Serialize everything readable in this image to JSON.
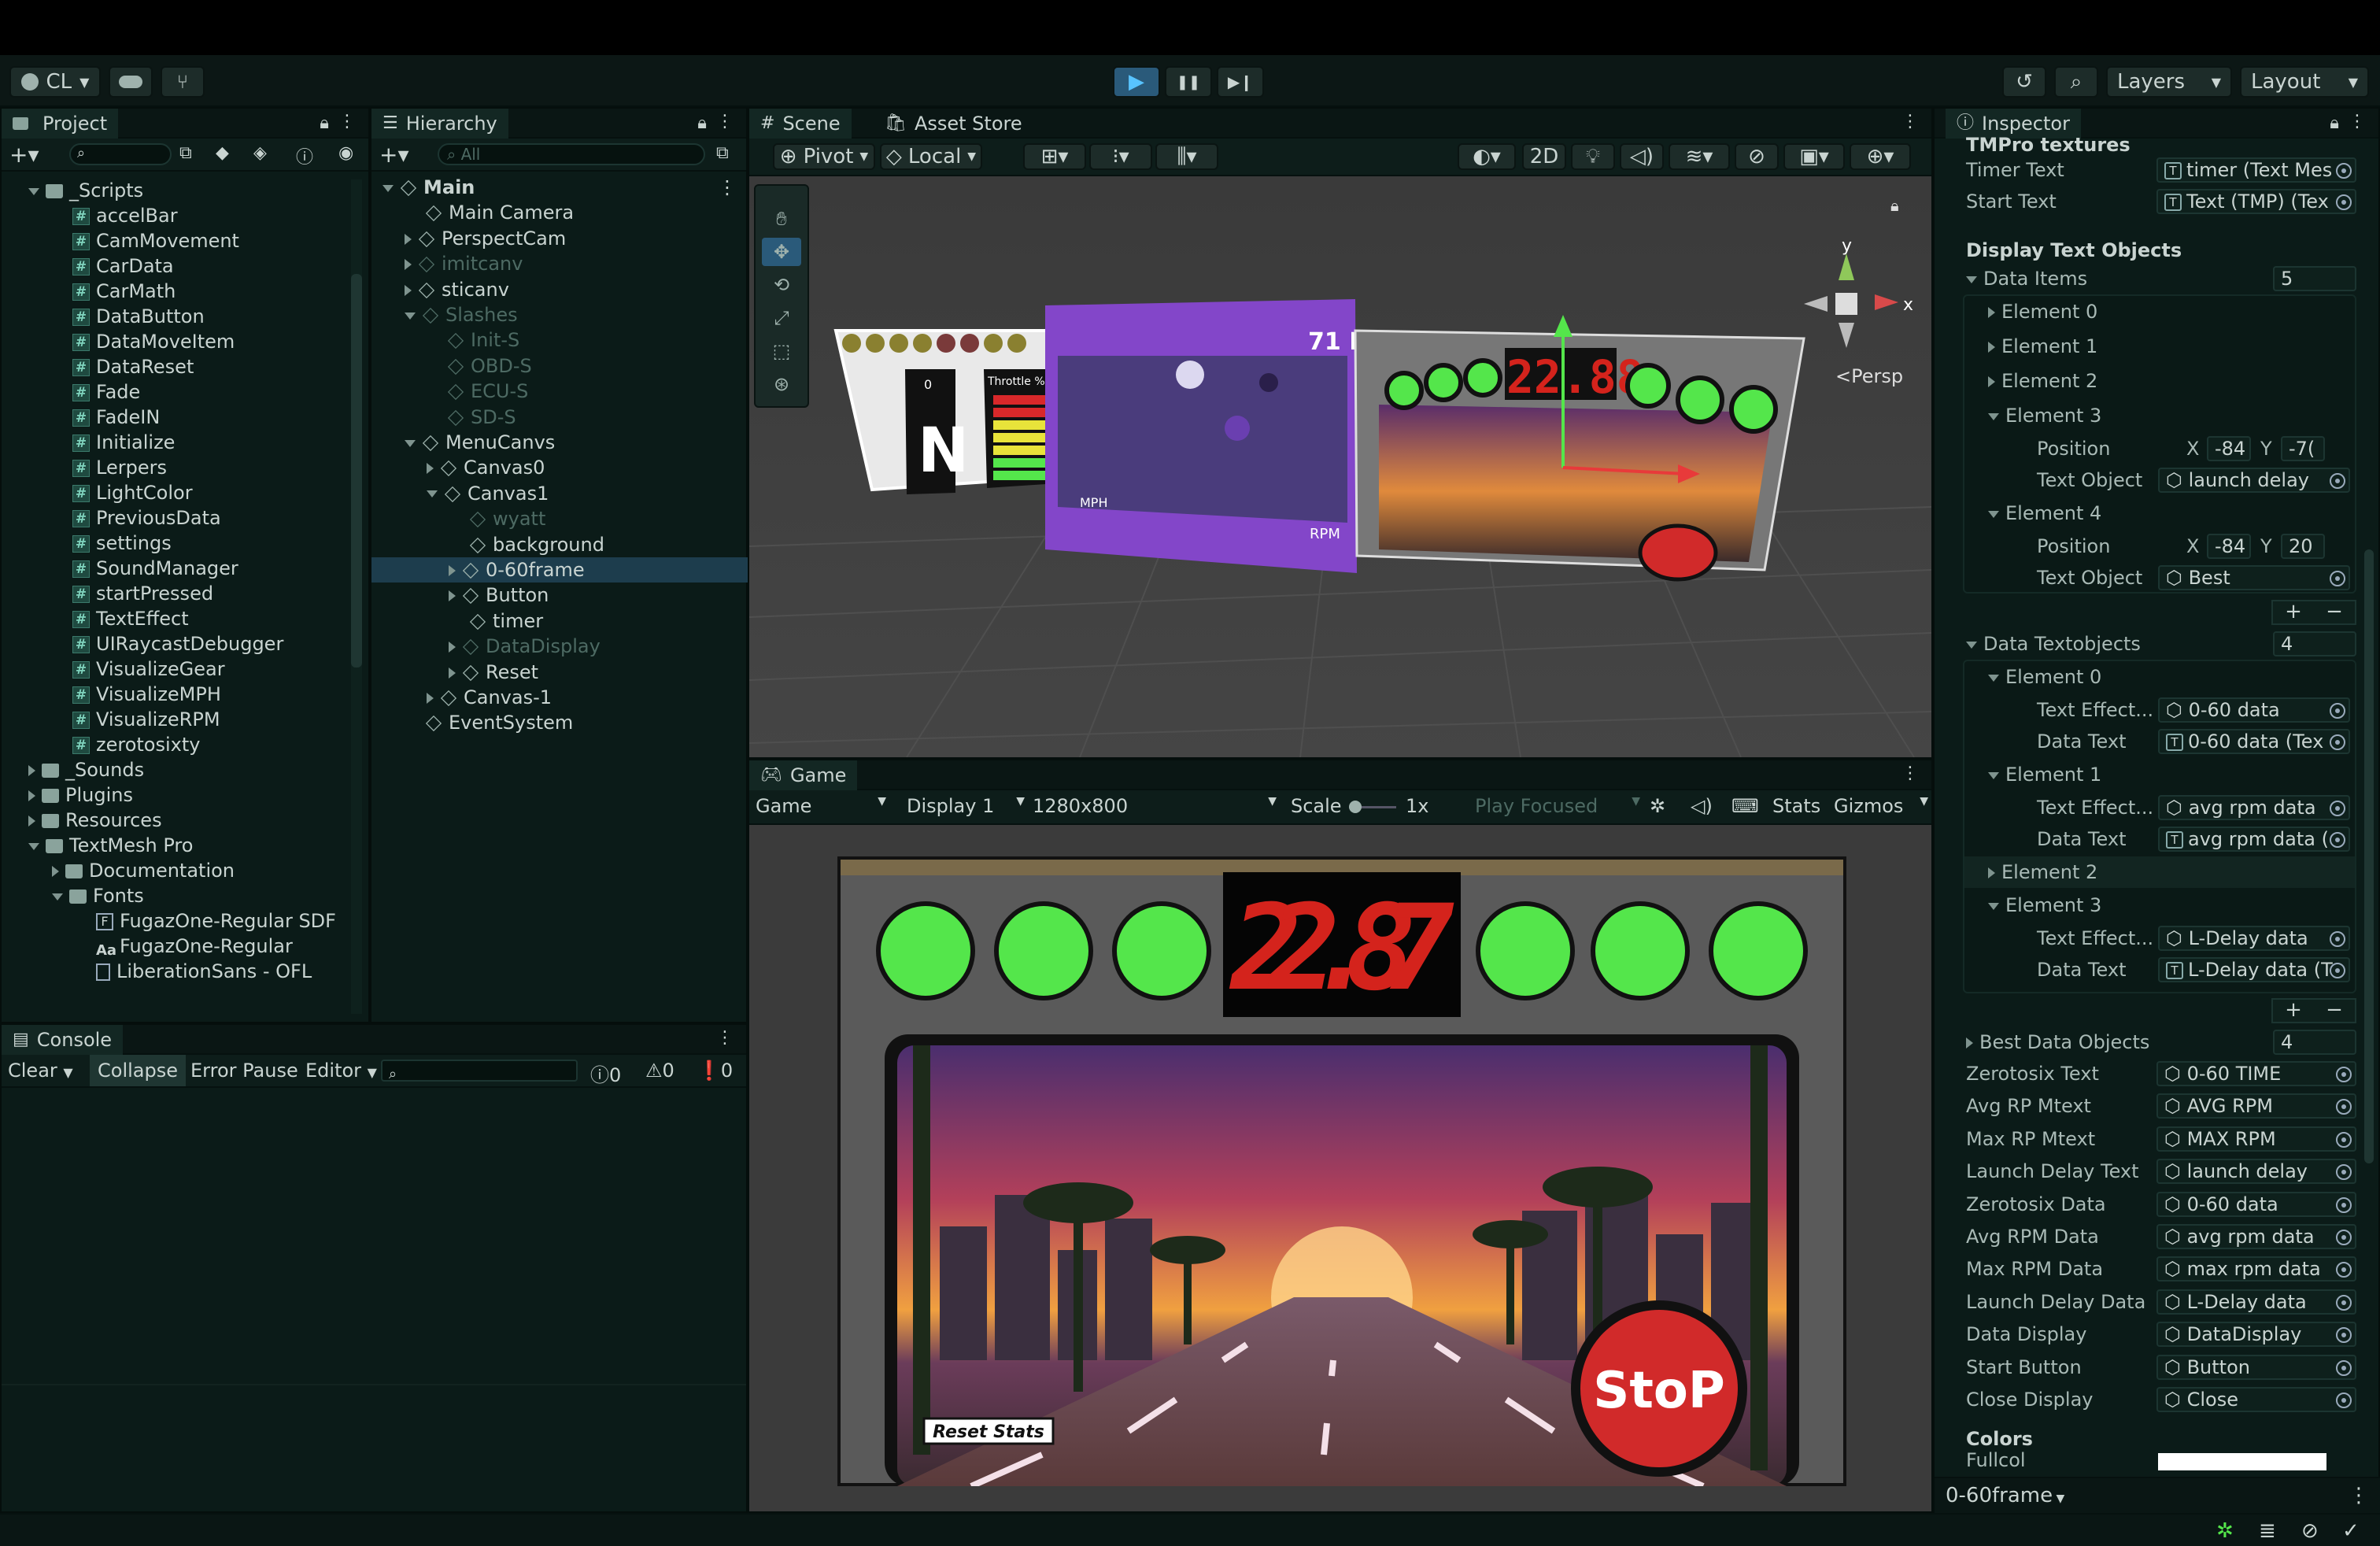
{
  "toolbar": {
    "account": "CL",
    "play_label": "▶",
    "pause_label": "❚❚",
    "step_label": "▶❙",
    "layers": "Layers",
    "layout": "Layout"
  },
  "project": {
    "tab": "Project",
    "items": [
      {
        "label": "_Scripts",
        "kind": "folder",
        "indent": 1,
        "open": true
      },
      {
        "label": "accelBar",
        "kind": "script",
        "indent": 2
      },
      {
        "label": "CamMovement",
        "kind": "script",
        "indent": 2
      },
      {
        "label": "CarData",
        "kind": "script",
        "indent": 2
      },
      {
        "label": "CarMath",
        "kind": "script",
        "indent": 2
      },
      {
        "label": "DataButton",
        "kind": "script",
        "indent": 2
      },
      {
        "label": "DataMoveItem",
        "kind": "script",
        "indent": 2
      },
      {
        "label": "DataReset",
        "kind": "script",
        "indent": 2
      },
      {
        "label": "Fade",
        "kind": "script",
        "indent": 2
      },
      {
        "label": "FadeIN",
        "kind": "script",
        "indent": 2
      },
      {
        "label": "Initialize",
        "kind": "script",
        "indent": 2
      },
      {
        "label": "Lerpers",
        "kind": "script",
        "indent": 2
      },
      {
        "label": "LightColor",
        "kind": "script",
        "indent": 2
      },
      {
        "label": "PreviousData",
        "kind": "script",
        "indent": 2
      },
      {
        "label": "settings",
        "kind": "script",
        "indent": 2
      },
      {
        "label": "SoundManager",
        "kind": "script",
        "indent": 2
      },
      {
        "label": "startPressed",
        "kind": "script",
        "indent": 2
      },
      {
        "label": "TextEffect",
        "kind": "script",
        "indent": 2
      },
      {
        "label": "UIRaycastDebugger",
        "kind": "script",
        "indent": 2
      },
      {
        "label": "VisualizeGear",
        "kind": "script",
        "indent": 2
      },
      {
        "label": "VisualizeMPH",
        "kind": "script",
        "indent": 2
      },
      {
        "label": "VisualizeRPM",
        "kind": "script",
        "indent": 2
      },
      {
        "label": "zerotosixty",
        "kind": "script",
        "indent": 2
      },
      {
        "label": "_Sounds",
        "kind": "folder",
        "indent": 1
      },
      {
        "label": "Plugins",
        "kind": "folder",
        "indent": 1
      },
      {
        "label": "Resources",
        "kind": "folder",
        "indent": 1
      },
      {
        "label": "TextMesh Pro",
        "kind": "folder",
        "indent": 1,
        "open": true
      },
      {
        "label": "Documentation",
        "kind": "folder",
        "indent": 2
      },
      {
        "label": "Fonts",
        "kind": "folder",
        "indent": 2,
        "open": true
      },
      {
        "label": "FugazOne-Regular SDF",
        "kind": "font",
        "indent": 3
      },
      {
        "label": "FugazOne-Regular",
        "kind": "fontaa",
        "indent": 3
      },
      {
        "label": "LiberationSans - OFL",
        "kind": "doc",
        "indent": 3
      }
    ]
  },
  "hierarchy": {
    "tab": "Hierarchy",
    "search_placeholder": "All",
    "items": [
      {
        "label": "Main",
        "indent": 0,
        "open": true,
        "bold": true
      },
      {
        "label": "Main Camera",
        "indent": 1
      },
      {
        "label": "PerspectCam",
        "indent": 1,
        "arrow": true
      },
      {
        "label": "imitcanv",
        "indent": 1,
        "arrow": true,
        "dim": true
      },
      {
        "label": "sticanv",
        "indent": 1,
        "arrow": true
      },
      {
        "label": "Slashes",
        "indent": 1,
        "open": true,
        "dim": true
      },
      {
        "label": "Init-S",
        "indent": 2,
        "dim": true
      },
      {
        "label": "OBD-S",
        "indent": 2,
        "dim": true
      },
      {
        "label": "ECU-S",
        "indent": 2,
        "dim": true
      },
      {
        "label": "SD-S",
        "indent": 2,
        "dim": true
      },
      {
        "label": "MenuCanvs",
        "indent": 1,
        "open": true
      },
      {
        "label": "Canvas0",
        "indent": 2,
        "arrow": true
      },
      {
        "label": "Canvas1",
        "indent": 2,
        "open": true
      },
      {
        "label": "wyatt",
        "indent": 3,
        "dim": true
      },
      {
        "label": "background",
        "indent": 3
      },
      {
        "label": "0-60frame",
        "indent": 3,
        "arrow": true,
        "selected": true
      },
      {
        "label": "Button",
        "indent": 3,
        "arrow": true
      },
      {
        "label": "timer",
        "indent": 3
      },
      {
        "label": "DataDisplay",
        "indent": 3,
        "arrow": true,
        "dim": true
      },
      {
        "label": "Reset",
        "indent": 3,
        "arrow": true
      },
      {
        "label": "Canvas-1",
        "indent": 2,
        "arrow": true
      },
      {
        "label": "EventSystem",
        "indent": 1
      }
    ]
  },
  "scene": {
    "tab_scene": "Scene",
    "tab_asset": "Asset Store",
    "pivot": "Pivot",
    "local": "Local",
    "mode_2d": "2D",
    "persp": "<Persp",
    "gizmo_y": "y",
    "gizmo_x": "x",
    "timer_small": "22.88",
    "gear": "N",
    "gear_top": "0",
    "throttle": "Throttle %",
    "mph": "MPH",
    "rpm": "RPM",
    "temp": "71 F"
  },
  "game": {
    "tab": "Game",
    "display_mode": "Game",
    "display": "Display 1",
    "resolution": "1280x800",
    "scale_label": "Scale",
    "scale_value": "1x",
    "play_focused": "Play Focused",
    "stats": "Stats",
    "gizmos": "Gizmos",
    "timer": "22.87",
    "reset_stats": "Reset Stats",
    "stop": "StoP"
  },
  "console": {
    "tab": "Console",
    "clear": "Clear",
    "collapse": "Collapse",
    "error_pause": "Error Pause",
    "editor": "Editor",
    "count_log": "0",
    "count_warn": "0",
    "count_err": "0"
  },
  "inspector": {
    "tab": "Inspector",
    "heading_tmp": "TMPro textures",
    "timer_text_label": "Timer Text",
    "timer_text_value": "timer (Text Mes",
    "start_text_label": "Start Text",
    "start_text_value": "Text (TMP) (Tex",
    "display_heading": "Display Text Objects",
    "data_items_label": "Data Items",
    "data_items_count": "5",
    "data_elements": [
      "Element 0",
      "Element 1",
      "Element 2",
      "Element 3",
      "Element 4"
    ],
    "position_label": "Position",
    "text_object_label": "Text Object",
    "el3_x": "-84",
    "el3_y": "-7(",
    "el3_text": "launch delay",
    "el4_x": "-84",
    "el4_y": "20",
    "el4_text": "Best",
    "x_label": "X",
    "y_label": "Y",
    "textobjects_label": "Data Textobjects",
    "textobjects_count": "4",
    "to_elements": [
      "Element 0",
      "Element 1",
      "Element 2",
      "Element 3"
    ],
    "text_effect_label": "Text Effect...",
    "data_text_label": "Data Text",
    "to0_effect": "0-60 data",
    "to0_data": "0-60 data (Tex",
    "to1_effect": "avg rpm data",
    "to1_data": "avg rpm data (",
    "to3_effect": "L-Delay data",
    "to3_data": "L-Delay data (T",
    "best_label": "Best Data Objects",
    "best_count": "4",
    "fields": [
      {
        "label": "Zerotosix Text",
        "value": "0-60 TIME"
      },
      {
        "label": "Avg RP Mtext",
        "value": "AVG RPM"
      },
      {
        "label": "Max RP Mtext",
        "value": "MAX RPM"
      },
      {
        "label": "Launch Delay Text",
        "value": "launch delay"
      },
      {
        "label": "Zerotosix Data",
        "value": "0-60 data"
      },
      {
        "label": "Avg RPM Data",
        "value": "avg rpm data"
      },
      {
        "label": "Max RPM Data",
        "value": "max rpm data"
      },
      {
        "label": "Launch Delay Data",
        "value": "L-Delay data"
      },
      {
        "label": "Data Display",
        "value": "DataDisplay"
      },
      {
        "label": "Start Button",
        "value": "Button"
      },
      {
        "label": "Close Display",
        "value": "Close"
      }
    ],
    "colors_heading": "Colors",
    "fullcol_label": "Fullcol",
    "plus": "+",
    "minus": "−"
  },
  "footer": {
    "selection": "0-60frame"
  },
  "colors": {
    "accent": "#54e64b",
    "timer_red": "#d4231c",
    "select": "#1d3d4d",
    "purple": "#8346c9"
  }
}
